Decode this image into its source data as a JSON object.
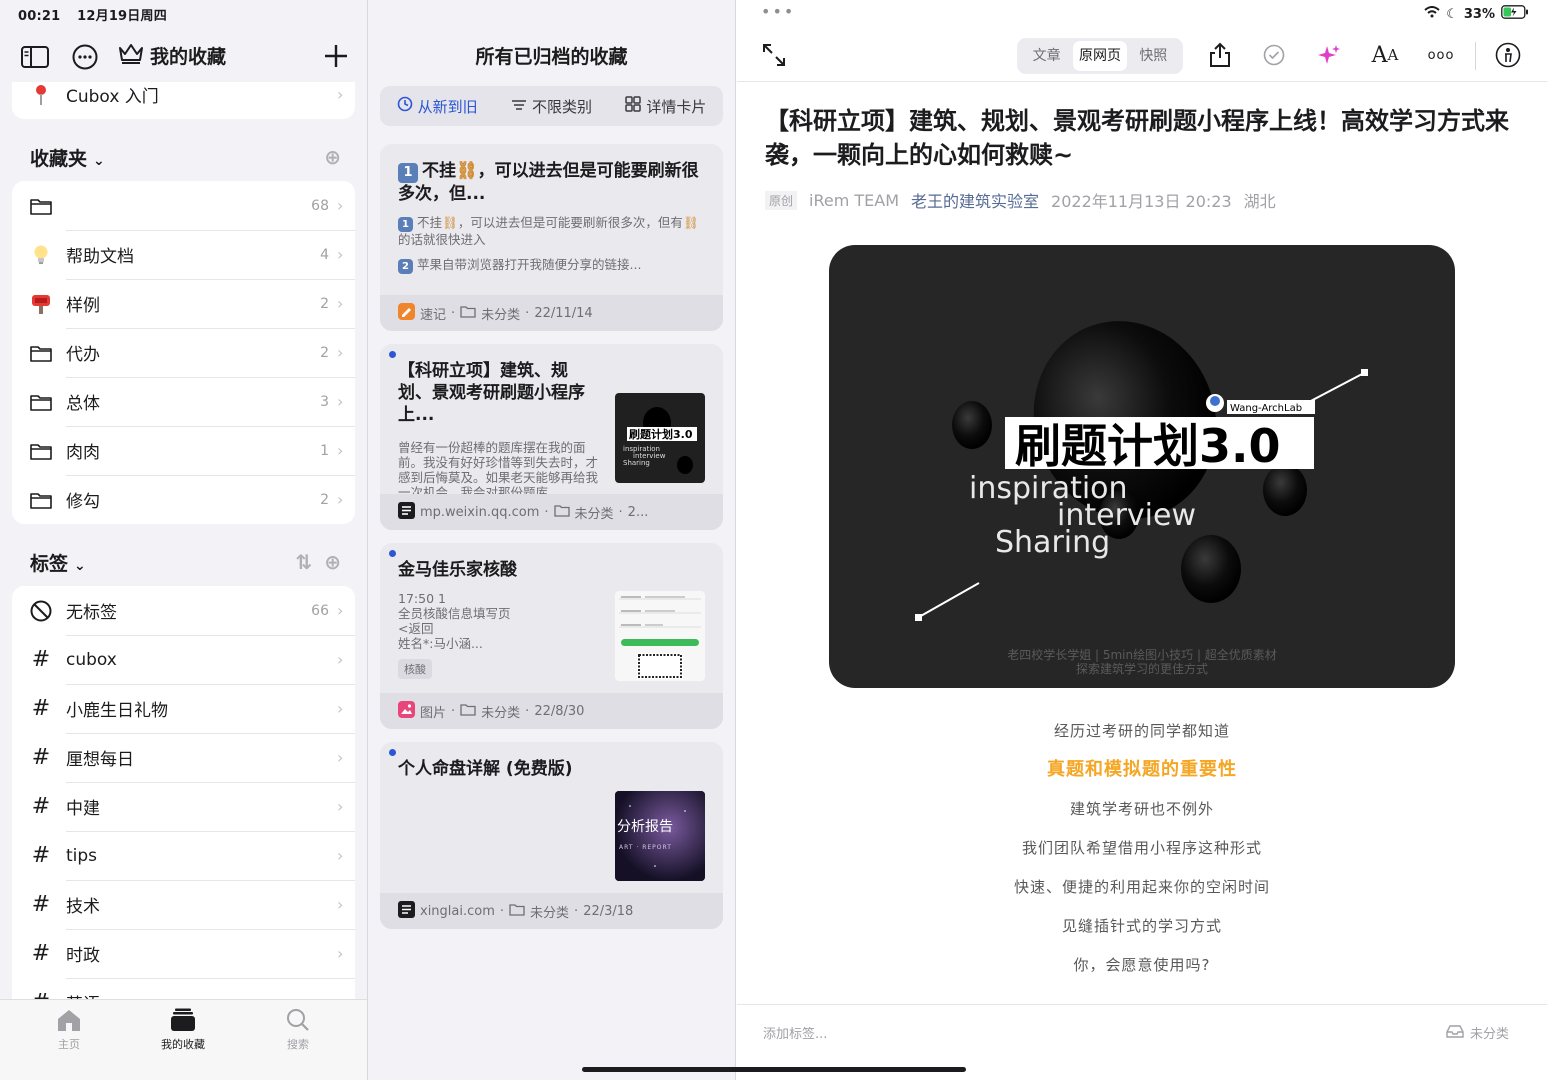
{
  "status": {
    "time": "00:21",
    "date": "12月19日周四",
    "battery": "33%"
  },
  "left": {
    "title": "我的收藏",
    "pinned": {
      "label": "Cubox 入门"
    },
    "folders_header": "收藏夹",
    "folders": [
      {
        "label": "",
        "count": "68",
        "icon": "folder-icon"
      },
      {
        "label": "帮助文档",
        "count": "4",
        "icon": "lightbulb-icon"
      },
      {
        "label": "样例",
        "count": "2",
        "icon": "mailbox-icon"
      },
      {
        "label": "代办",
        "count": "2",
        "icon": "folder-icon"
      },
      {
        "label": "总体",
        "count": "3",
        "icon": "folder-icon"
      },
      {
        "label": "肉肉",
        "count": "1",
        "icon": "folder-icon"
      },
      {
        "label": "修勾",
        "count": "2",
        "icon": "folder-icon"
      }
    ],
    "tags_header": "标签",
    "tags": [
      {
        "label": "无标签",
        "count": "66"
      },
      {
        "label": "cubox",
        "count": ""
      },
      {
        "label": "小鹿生日礼物",
        "count": ""
      },
      {
        "label": "厘想每日",
        "count": ""
      },
      {
        "label": "中建",
        "count": ""
      },
      {
        "label": "tips",
        "count": ""
      },
      {
        "label": "技术",
        "count": ""
      },
      {
        "label": "时政",
        "count": ""
      },
      {
        "label": "英语",
        "count": ""
      }
    ],
    "tabs": [
      {
        "label": "主页",
        "icon": "home-icon"
      },
      {
        "label": "我的收藏",
        "icon": "collection-icon"
      },
      {
        "label": "搜索",
        "icon": "search-icon"
      }
    ]
  },
  "mid": {
    "title": "所有已归档的收藏",
    "filters": {
      "sort": "从新到旧",
      "category": "不限类别",
      "view": "详情卡片"
    },
    "items": [
      {
        "title_a": "不挂",
        "title_b": "，可以进去但是可能要刷新很多次，但...",
        "excerpt_1a": "不挂",
        "excerpt_1b": "，可以进去但是可能要刷新很多次，但有",
        "excerpt_1c": "的话就很快进入",
        "excerpt_2": "苹果自带浏览器打开我随便分享的链接...",
        "badge1": "1",
        "badge2": "2",
        "source": "速记",
        "folder": "未分类",
        "date": "22/11/14"
      },
      {
        "title": "【科研立项】建筑、规划、景观考研刷题小程序上...",
        "excerpt": "曾经有一份超棒的题库摆在我的面前。我没有好好珍惜等到失去时，才感到后悔莫及。如果老天能够再给我一次机会，我会对那份题库...",
        "source": "mp.weixin.qq.com",
        "folder": "未分类",
        "date": "2..."
      },
      {
        "title": "金马佳乐家核酸",
        "excerpt": "17:50 1\n全员核酸信息填写页\n<返回\n姓名*:马小涵...",
        "tag": "核酸",
        "source": "图片",
        "folder": "未分类",
        "date": "22/8/30"
      },
      {
        "title": "个人命盘详解 (免费版)",
        "thumb_text": "分析报告",
        "thumb_sub": "ART · REPORT",
        "source": "xinglai.com",
        "folder": "未分类",
        "date": "22/3/18"
      }
    ]
  },
  "right": {
    "segments": [
      "文章",
      "原网页",
      "快照"
    ],
    "title": "【科研立项】建筑、规划、景观考研刷题小程序上线！高效学习方式来袭，一颗向上的心如何救赎~",
    "meta": {
      "tag": "原创",
      "author": "iRem TEAM",
      "account": "老王的建筑实验室",
      "datetime": "2022年11月13日 20:23",
      "location": "湖北"
    },
    "hero": {
      "headline": "刷题计划3.0",
      "brand": "Wang-ArchLab",
      "line1": "inspiration",
      "line2": "interview",
      "line3": "Sharing",
      "caption1": "老四校学长学姐 | 5min绘图小技巧 | 超全优质素材",
      "caption2": "探索建筑学习的更佳方式"
    },
    "body": [
      "经历过考研的同学都知道",
      "真题和模拟题的重要性",
      "建筑学考研也不例外",
      "我们团队希望借用小程序这种形式",
      "快速、便捷的利用起来你的空闲时间",
      "见缝插针式的学习方式",
      "你，会愿意使用吗?"
    ],
    "add_tag_placeholder": "添加标签...",
    "uncategorized": "未分类"
  },
  "colors": {
    "accent": "#2c56d6",
    "highlight": "#f5a623",
    "wechat_link": "#576b95",
    "magic": "#e040c8"
  }
}
